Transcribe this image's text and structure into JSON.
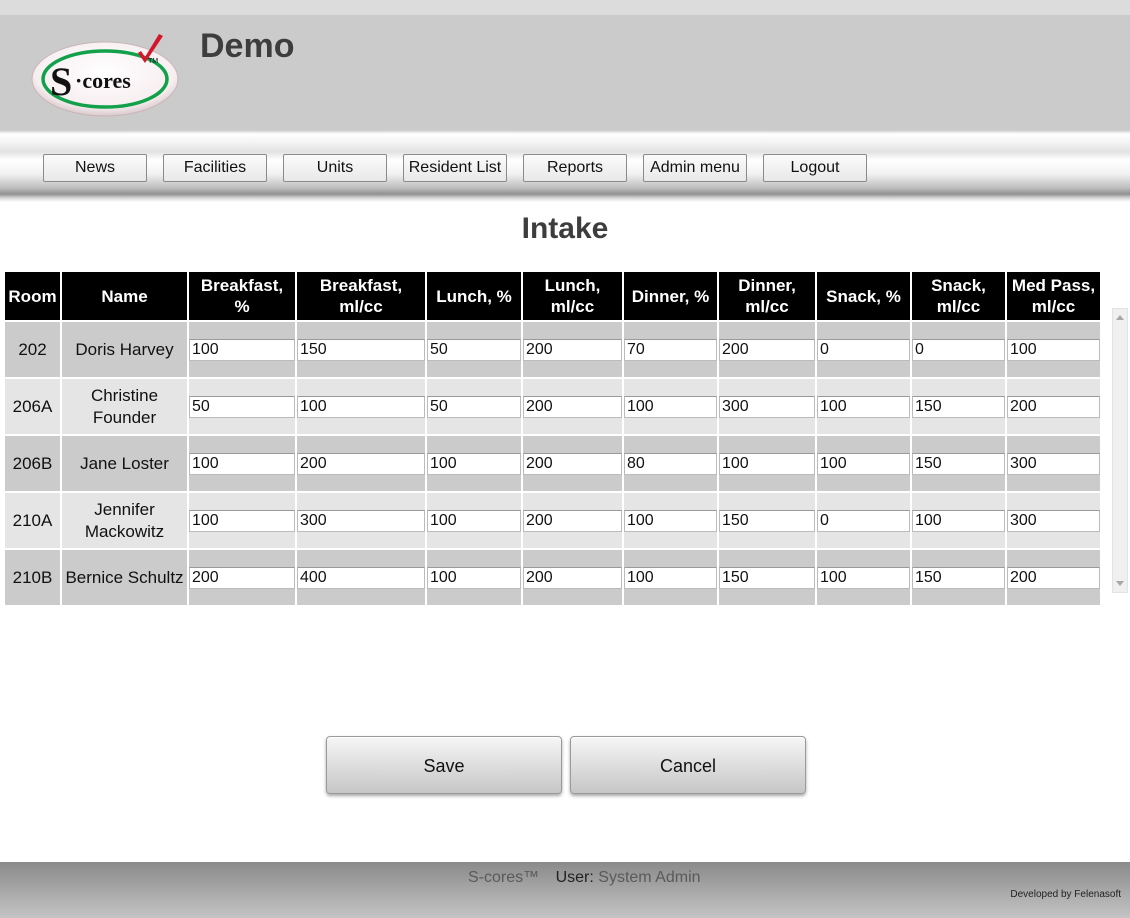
{
  "app": {
    "logo_text": "S·cores",
    "logo_tm": "TM",
    "site_title": "Demo"
  },
  "nav": {
    "items": [
      {
        "label": "News"
      },
      {
        "label": "Facilities"
      },
      {
        "label": "Units"
      },
      {
        "label": "Resident List"
      },
      {
        "label": "Reports"
      },
      {
        "label": "Admin menu"
      },
      {
        "label": "Logout"
      }
    ]
  },
  "page": {
    "title": "Intake"
  },
  "table": {
    "headers": [
      "Room",
      "Name",
      "Breakfast, %",
      "Breakfast, ml/cc",
      "Lunch, %",
      "Lunch, ml/cc",
      "Dinner, %",
      "Dinner, ml/cc",
      "Snack, %",
      "Snack, ml/cc",
      "Med Pass, ml/cc"
    ],
    "rows": [
      {
        "room": "202",
        "name": "Doris Harvey",
        "values": [
          "100",
          "150",
          "50",
          "200",
          "70",
          "200",
          "0",
          "0",
          "100"
        ]
      },
      {
        "room": "206A",
        "name": "Christine Founder",
        "values": [
          "50",
          "100",
          "50",
          "200",
          "100",
          "300",
          "100",
          "150",
          "200"
        ]
      },
      {
        "room": "206B",
        "name": "Jane Loster",
        "values": [
          "100",
          "200",
          "100",
          "200",
          "80",
          "100",
          "100",
          "150",
          "300"
        ]
      },
      {
        "room": "210A",
        "name": "Jennifer Mackowitz",
        "values": [
          "100",
          "300",
          "100",
          "200",
          "100",
          "150",
          "0",
          "100",
          "300"
        ]
      },
      {
        "room": "210B",
        "name": "Bernice Schultz",
        "values": [
          "200",
          "400",
          "100",
          "200",
          "100",
          "150",
          "100",
          "150",
          "200"
        ]
      }
    ]
  },
  "actions": {
    "save_label": "Save",
    "cancel_label": "Cancel"
  },
  "footer": {
    "brand": "S-cores™",
    "user_label": "User:",
    "user_name": "System Admin",
    "developer": "Developed by Felenasoft"
  }
}
